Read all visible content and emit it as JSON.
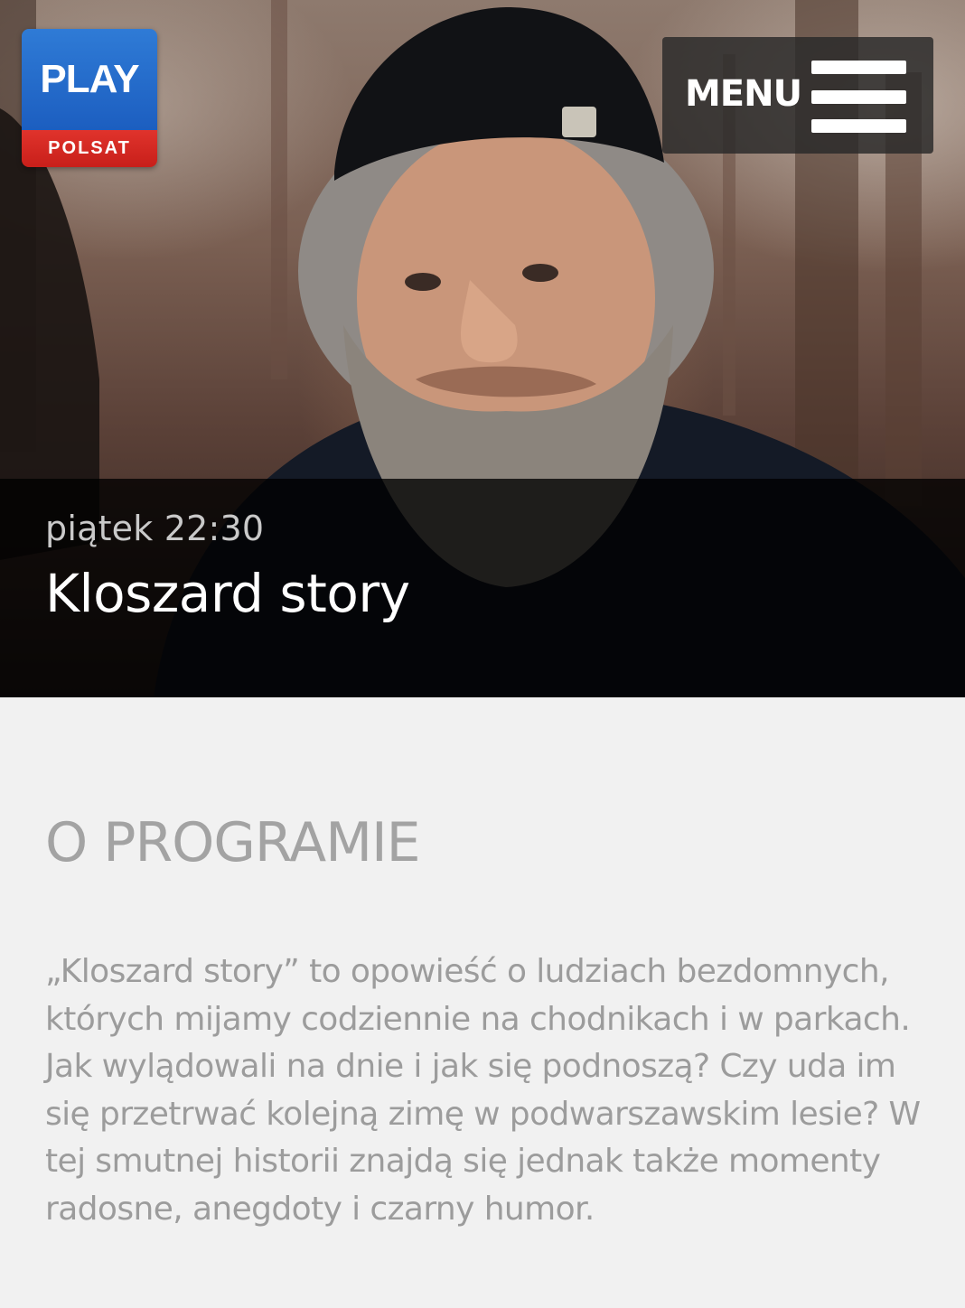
{
  "logo": {
    "brand_top": "PLAY",
    "brand_bottom": "POLSAT",
    "colors": {
      "top": "#1c5ec0",
      "bottom": "#c81f1a"
    }
  },
  "header": {
    "menu_label": "MENU"
  },
  "hero": {
    "air_time": "piątek 22:30",
    "title": "Kloszard story"
  },
  "about": {
    "heading": "O PROGRAMIE",
    "description": "„Kloszard story” to opowieść o ludziach bezdomnych, których mijamy codziennie na chodnikach i w parkach. Jak wylądowali na dnie i jak się podnoszą? Czy uda im się przetrwać kolejną zimę w podwarszawskim lesie? W tej smutnej historii znajdą się jednak także momenty radosne, anegdoty i czarny humor."
  }
}
